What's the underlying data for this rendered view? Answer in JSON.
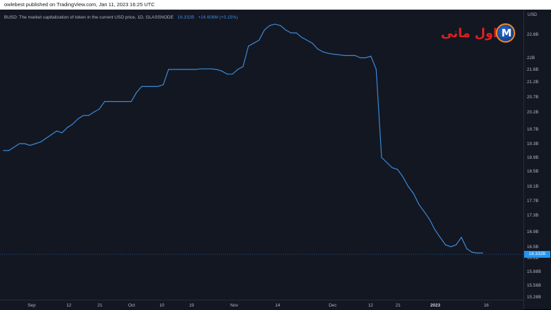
{
  "header": {
    "publish_note": "owlebest published on TradingView.com, Jan 11, 2023 16:25 UTC"
  },
  "legend": {
    "title": "BUSD: The market capitalization of token in the current USD price, 1D, GLASSNODE",
    "value": "16.332B",
    "change": "+24.608M (+0.15%)"
  },
  "watermark": {
    "text": "اول مانی",
    "logo_letter": "M"
  },
  "price_axis": {
    "currency": "USD",
    "last_price_label": "16.332B"
  },
  "colors": {
    "line": "#3c8bd9",
    "background": "#131722",
    "last_price_tag": "#2196f3"
  },
  "chart_data": {
    "type": "line",
    "series": [
      {
        "values": [
          [
            0,
            19.1
          ],
          [
            1,
            19.1
          ],
          [
            2,
            19.2
          ],
          [
            3,
            19.3
          ],
          [
            4,
            19.3
          ],
          [
            5,
            19.25
          ],
          [
            6,
            19.3
          ],
          [
            7,
            19.35
          ],
          [
            8,
            19.45
          ],
          [
            9,
            19.55
          ],
          [
            10,
            19.65
          ],
          [
            11,
            19.6
          ],
          [
            12,
            19.75
          ],
          [
            13,
            19.85
          ],
          [
            14,
            20.0
          ],
          [
            15,
            20.1
          ],
          [
            16,
            20.1
          ],
          [
            17,
            20.2
          ],
          [
            18,
            20.3
          ],
          [
            19,
            20.55
          ],
          [
            20,
            20.55
          ],
          [
            21,
            20.55
          ],
          [
            22,
            20.55
          ],
          [
            23,
            20.55
          ],
          [
            24,
            20.55
          ],
          [
            25,
            20.85
          ],
          [
            26,
            21.05
          ],
          [
            27,
            21.05
          ],
          [
            28,
            21.05
          ],
          [
            29,
            21.05
          ],
          [
            30,
            21.1
          ],
          [
            31,
            21.6
          ],
          [
            32,
            21.6
          ],
          [
            33,
            21.6
          ],
          [
            34,
            21.6
          ],
          [
            35,
            21.6
          ],
          [
            36,
            21.6
          ],
          [
            37,
            21.62
          ],
          [
            38,
            21.62
          ],
          [
            39,
            21.62
          ],
          [
            40,
            21.6
          ],
          [
            41,
            21.55
          ],
          [
            42,
            21.45
          ],
          [
            43,
            21.45
          ],
          [
            44,
            21.6
          ],
          [
            45,
            21.7
          ],
          [
            46,
            22.4
          ],
          [
            47,
            22.5
          ],
          [
            48,
            22.6
          ],
          [
            49,
            22.95
          ],
          [
            50,
            23.1
          ],
          [
            51,
            23.15
          ],
          [
            52,
            23.1
          ],
          [
            53,
            22.95
          ],
          [
            54,
            22.85
          ],
          [
            55,
            22.85
          ],
          [
            56,
            22.7
          ],
          [
            57,
            22.6
          ],
          [
            58,
            22.5
          ],
          [
            59,
            22.3
          ],
          [
            60,
            22.2
          ],
          [
            61,
            22.15
          ],
          [
            62,
            22.12
          ],
          [
            63,
            22.1
          ],
          [
            64,
            22.08
          ],
          [
            65,
            22.08
          ],
          [
            66,
            22.08
          ],
          [
            67,
            22.0
          ],
          [
            68,
            22.0
          ],
          [
            69,
            22.05
          ],
          [
            70,
            21.6
          ],
          [
            71,
            18.9
          ],
          [
            72,
            18.75
          ],
          [
            73,
            18.6
          ],
          [
            74,
            18.55
          ],
          [
            75,
            18.35
          ],
          [
            76,
            18.1
          ],
          [
            77,
            17.9
          ],
          [
            78,
            17.6
          ],
          [
            79,
            17.4
          ],
          [
            80,
            17.2
          ],
          [
            81,
            16.95
          ],
          [
            82,
            16.75
          ],
          [
            83,
            16.55
          ],
          [
            84,
            16.5
          ],
          [
            85,
            16.55
          ],
          [
            86,
            16.75
          ],
          [
            87,
            16.45
          ],
          [
            88,
            16.35
          ],
          [
            89,
            16.33
          ],
          [
            90,
            16.332
          ]
        ]
      }
    ],
    "x_axis_ticks": [
      "Sep",
      "12",
      "21",
      "Oct",
      "10",
      "19",
      "Nov",
      "14",
      "Dec",
      "12",
      "21",
      "2023",
      "16"
    ],
    "y_axis_ticks": [
      "22.8B",
      "22B",
      "21.6B",
      "21.2B",
      "20.7B",
      "20.2B",
      "19.7B",
      "19.3B",
      "18.9B",
      "18.5B",
      "18.1B",
      "17.7B",
      "17.3B",
      "16.9B",
      "16.5B",
      "16.2B",
      "15.88B",
      "15.56B",
      "15.28B"
    ],
    "xlim": [
      0,
      97
    ],
    "grid": false,
    "legend_position": "top-left"
  }
}
